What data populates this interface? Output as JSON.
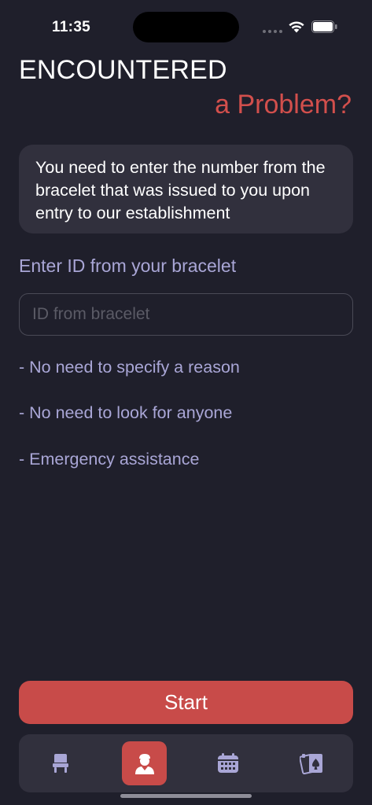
{
  "status_bar": {
    "time": "11:35",
    "icons": [
      "signal-dots-icon",
      "wifi-icon",
      "battery-icon"
    ]
  },
  "header": {
    "title_main": "ENCOUNTERED",
    "title_accent": "a Problem?"
  },
  "info_card": {
    "text": "You need to enter the number from the bracelet that was issued to you upon entry to our establishment"
  },
  "form": {
    "label": "Enter ID from your bracelet",
    "input_value": "",
    "input_placeholder": "ID from bracelet"
  },
  "features": [
    "- No need to specify a reason",
    "- No need to look for anyone",
    "- Emergency assistance"
  ],
  "start_button": {
    "label": "Start"
  },
  "tab_bar": {
    "tabs": [
      {
        "icon": "chair-icon",
        "active": false
      },
      {
        "icon": "staff-person-icon",
        "active": true
      },
      {
        "icon": "calendar-icon",
        "active": false
      },
      {
        "icon": "playing-cards-icon",
        "active": false
      }
    ]
  },
  "colors": {
    "background": "#1f1f2b",
    "card": "#31303d",
    "accent": "#c84b49",
    "accent_text": "#d24f4c",
    "label": "#a9a6d6",
    "icon_inactive": "#a9a6d6"
  }
}
